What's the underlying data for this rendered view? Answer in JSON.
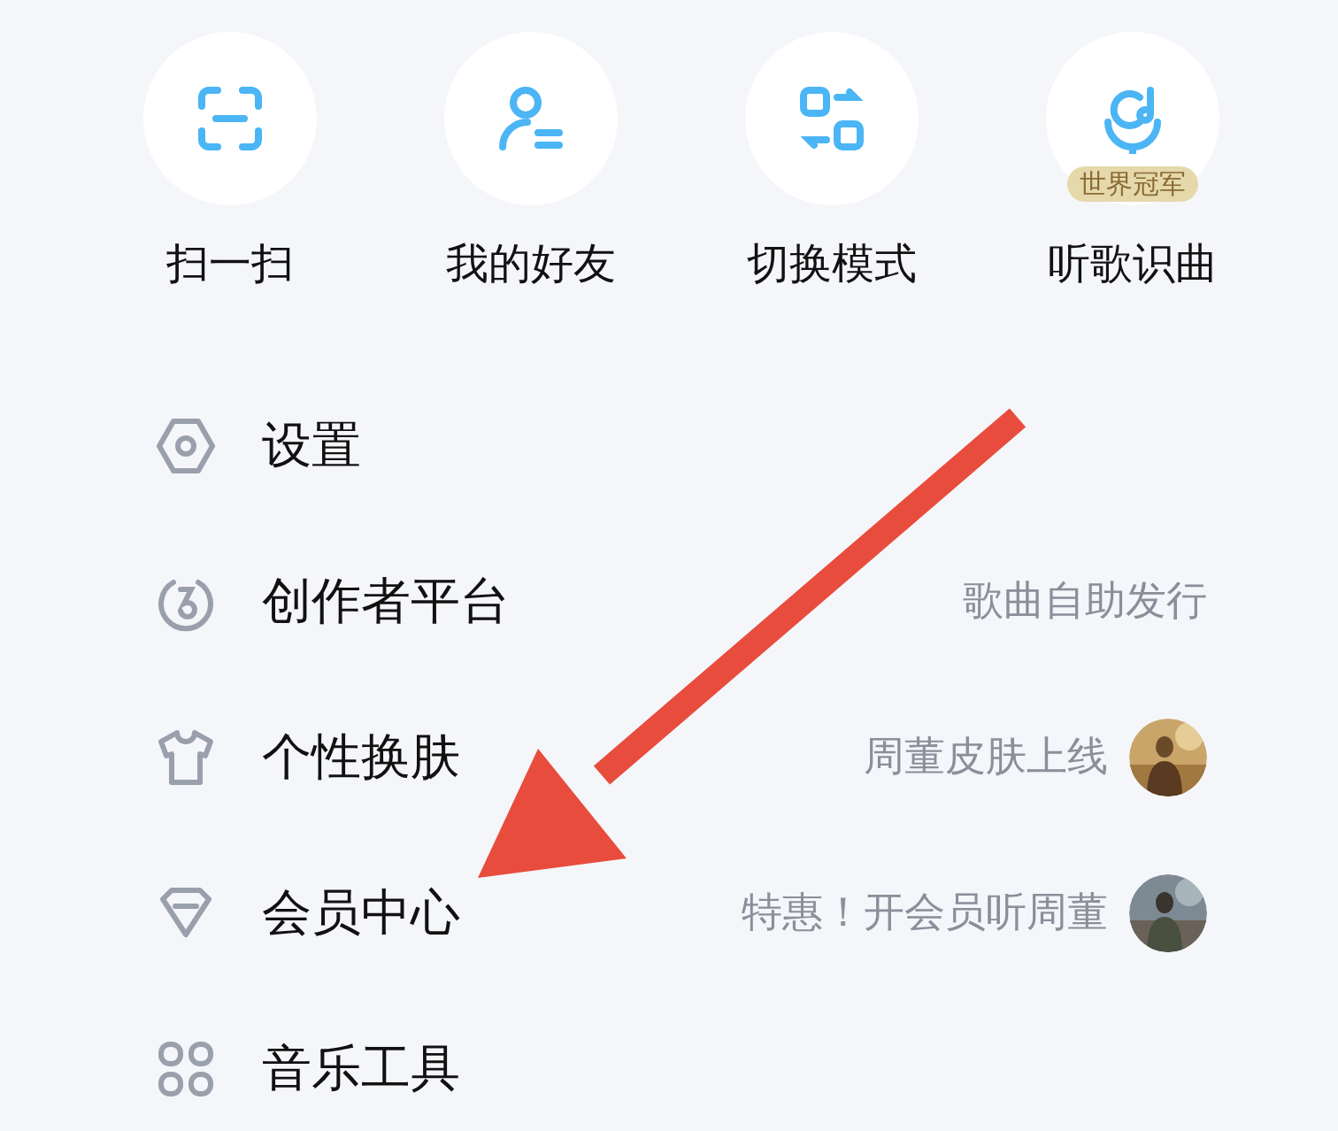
{
  "quick_actions": [
    {
      "label": "扫一扫"
    },
    {
      "label": "我的好友"
    },
    {
      "label": "切换模式"
    },
    {
      "label": "听歌识曲",
      "badge": "世界冠军"
    }
  ],
  "menu": [
    {
      "label": "设置"
    },
    {
      "label": "创作者平台",
      "note": "歌曲自助发行"
    },
    {
      "label": "个性换肤",
      "note": "周董皮肤上线"
    },
    {
      "label": "会员中心",
      "note": "特惠！开会员听周董"
    },
    {
      "label": "音乐工具"
    }
  ],
  "annotation": {
    "kind": "arrow"
  }
}
